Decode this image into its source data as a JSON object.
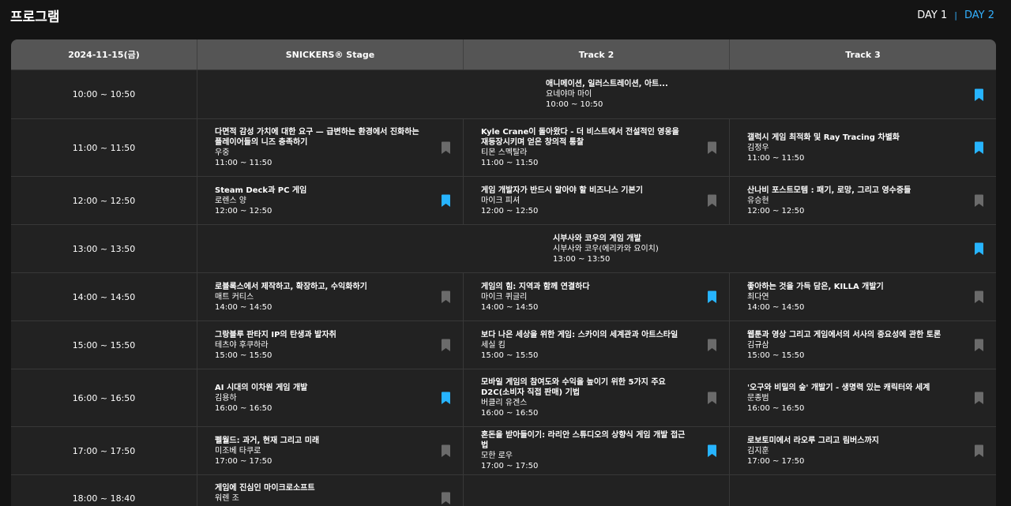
{
  "page_title": "프로그램",
  "days": [
    {
      "label": "DAY 1",
      "active": false
    },
    {
      "label": "DAY 2",
      "active": true
    }
  ],
  "colors": {
    "accent": "#33b1ff",
    "bookmark_on": "#27b4ff",
    "bookmark_off": "#6b6b6b",
    "header_bg": "#555555",
    "row_bg": "#222222"
  },
  "header": {
    "date": "2024-11-15(금)",
    "tracks": [
      "SNICKERS® Stage",
      "Track 2",
      "Track 3"
    ]
  },
  "rows": [
    {
      "time": "10:00 ~ 10:50",
      "span": {
        "title": "애니메이션, 일러스트레이션, 아트...",
        "speaker": "요네야마 마이",
        "time": "10:00 ~ 10:50",
        "bookmarked": true
      }
    },
    {
      "time": "11:00 ~ 11:50",
      "cells": [
        {
          "title": "다면적 감성 가치에 대한 요구 — 급변하는 환경에서 진화하는 플레이어들의 니즈 충족하기",
          "speaker": "우중",
          "time": "11:00 ~ 11:50",
          "bookmarked": false
        },
        {
          "title": "Kyle Crane이 돌아왔다 - 더 비스트에서 전설적인 영웅을 재등장시키며 얻은 창의적 통찰",
          "speaker": "티몬 스멕탈라",
          "time": "11:00 ~ 11:50",
          "bookmarked": false
        },
        {
          "title": "갤럭시 게임 최적화 및 Ray Tracing 차별화",
          "speaker": "김정우",
          "time": "11:00 ~ 11:50",
          "bookmarked": true
        }
      ]
    },
    {
      "time": "12:00 ~ 12:50",
      "cells": [
        {
          "title": "Steam Deck과 PC 게임",
          "speaker": "로렌스 양",
          "time": "12:00 ~ 12:50",
          "bookmarked": true
        },
        {
          "title": "게임 개발자가 반드시 알아야 할 비즈니스 기본기",
          "speaker": "마이크 피셔",
          "time": "12:00 ~ 12:50",
          "bookmarked": false
        },
        {
          "title": "산나비 포스트모템 : 패기, 로망, 그리고 영수증들",
          "speaker": "유승현",
          "time": "12:00 ~ 12:50",
          "bookmarked": false
        }
      ]
    },
    {
      "time": "13:00 ~ 13:50",
      "span": {
        "title": "시부사와 코우의 게임 개발",
        "speaker": "시부사와 코우(에리카와 요이치)",
        "time": "13:00 ~ 13:50",
        "bookmarked": true
      }
    },
    {
      "time": "14:00 ~ 14:50",
      "cells": [
        {
          "title": "로블록스에서 제작하고, 확장하고, 수익화하기",
          "speaker": "매트 커티스",
          "time": "14:00 ~ 14:50",
          "bookmarked": false
        },
        {
          "title": "게임의 힘: 지역과 함께 연결하다",
          "speaker": "마이크 퀴글리",
          "time": "14:00 ~ 14:50",
          "bookmarked": true
        },
        {
          "title": "좋아하는 것을 가득 담은, KILLA 개발기",
          "speaker": "최다연",
          "time": "14:00 ~ 14:50",
          "bookmarked": false
        }
      ]
    },
    {
      "time": "15:00 ~ 15:50",
      "cells": [
        {
          "title": "그랑블루 판타지 IP의 탄생과 발자취",
          "speaker": "테츠야 후쿠하라",
          "time": "15:00 ~ 15:50",
          "bookmarked": false
        },
        {
          "title": "보다 나은 세상을 위한 게임: 스카이의 세계관과 아트스타일",
          "speaker": "세실 킴",
          "time": "15:00 ~ 15:50",
          "bookmarked": false
        },
        {
          "title": "웹툰과 영상 그리고 게임에서의 서사의 중요성에 관한 토론",
          "speaker": "김규삼",
          "time": "15:00 ~ 15:50",
          "bookmarked": false
        }
      ]
    },
    {
      "time": "16:00 ~ 16:50",
      "cells": [
        {
          "title": "AI 시대의 이차원 게임 개발",
          "speaker": "김용하",
          "time": "16:00 ~ 16:50",
          "bookmarked": true
        },
        {
          "title": "모바일 게임의 참여도와 수익을 높이기 위한 5가지 주요 D2C(소비자 직접 판매) 기법",
          "speaker": "버클리 유겐스",
          "time": "16:00 ~ 16:50",
          "bookmarked": false
        },
        {
          "title": "'오구와 비밀의 숲' 개발기 - 생명력 있는 캐릭터와 세계",
          "speaker": "문종범",
          "time": "16:00 ~ 16:50",
          "bookmarked": false
        }
      ]
    },
    {
      "time": "17:00 ~ 17:50",
      "cells": [
        {
          "title": "펠월드: 과거, 현재 그리고 미래",
          "speaker": "미조베 타쿠로",
          "time": "17:00 ~ 17:50",
          "bookmarked": false
        },
        {
          "title": "혼돈을 받아들이기: 라리안 스튜디오의 상향식 게임 개발 접근법",
          "speaker": "모한 로우",
          "time": "17:00 ~ 17:50",
          "bookmarked": true
        },
        {
          "title": "로보토미에서 라오루 그리고 림버스까지",
          "speaker": "김지훈",
          "time": "17:00 ~ 17:50",
          "bookmarked": false
        }
      ]
    },
    {
      "time": "18:00 ~ 18:40",
      "cells": [
        {
          "title": "게임에 진심인 마이크로소프트",
          "speaker": "워렌 조",
          "time": "",
          "bookmarked": false
        },
        null,
        null
      ]
    }
  ]
}
